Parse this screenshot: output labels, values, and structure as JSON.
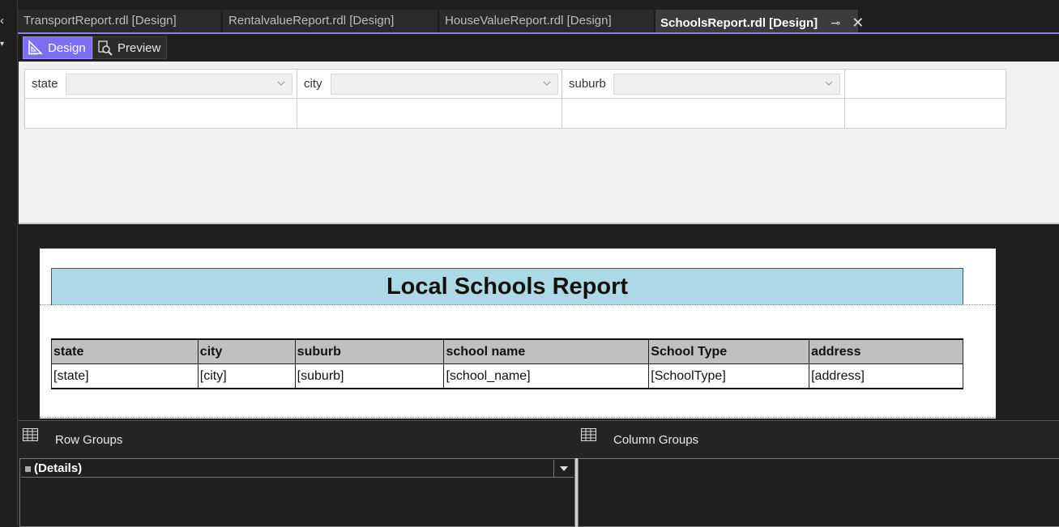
{
  "left_strip": {
    "top_glyph": "‹",
    "dropdown_glyph": "▾"
  },
  "tabs": [
    {
      "label": "TransportReport.rdl [Design]",
      "active": false
    },
    {
      "label": "RentalvalueReport.rdl [Design]",
      "active": false
    },
    {
      "label": "HouseValueReport.rdl [Design]",
      "active": false
    },
    {
      "label": "SchoolsReport.rdl [Design]",
      "active": true,
      "pin_icon": "pin-icon",
      "close_icon": "close-icon"
    }
  ],
  "toolbar": {
    "design_label": "Design",
    "preview_label": "Preview",
    "design_icon": "ruler-triangle-icon",
    "preview_icon": "preview-magnifier-icon"
  },
  "parameters": [
    {
      "label": "state",
      "value": ""
    },
    {
      "label": "city",
      "value": ""
    },
    {
      "label": "suburb",
      "value": ""
    }
  ],
  "report": {
    "title": "Local Schools Report",
    "columns": [
      "state",
      "city",
      "suburb",
      "school name",
      "School Type",
      "address"
    ],
    "row": [
      "[state]",
      "[city]",
      "[suburb]",
      "[school_name]",
      "[SchoolType]",
      "[address]"
    ]
  },
  "groups": {
    "row_groups_label": "Row Groups",
    "column_groups_label": "Column Groups",
    "row_group_items": [
      "(Details)"
    ]
  },
  "colors": {
    "accent": "#7a6ff0",
    "title_band": "#add8e6",
    "header_row": "#c0c0c0"
  }
}
